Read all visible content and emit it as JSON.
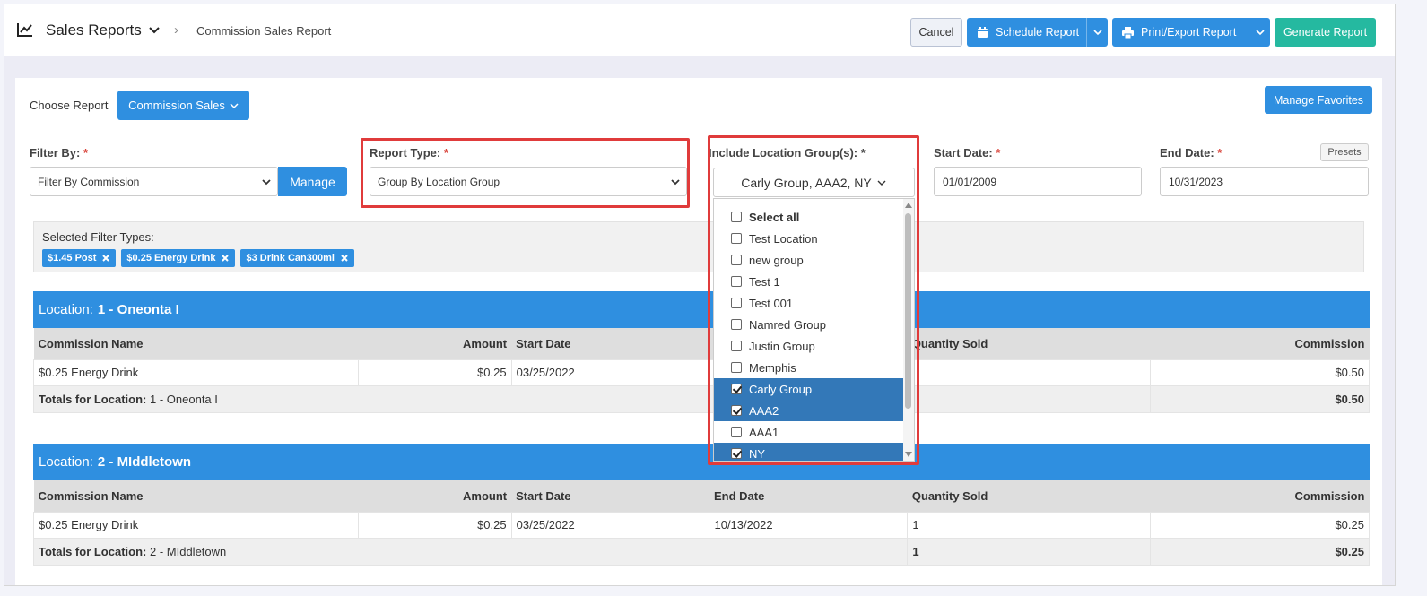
{
  "header": {
    "app_title": "Sales Reports",
    "breadcrumb_current": "Commission Sales Report",
    "cancel_label": "Cancel",
    "schedule_label": "Schedule Report",
    "print_label": "Print/Export Report",
    "generate_label": "Generate Report"
  },
  "choose_report": {
    "label": "Choose Report",
    "value": "Commission Sales"
  },
  "manage_favorites_label": "Manage Favorites",
  "filter_by": {
    "label": "Filter By:",
    "required": "*",
    "value": "Filter By Commission",
    "manage_label": "Manage"
  },
  "report_type": {
    "label": "Report Type:",
    "required": "*",
    "value": "Group By Location Group"
  },
  "location_groups": {
    "label": "Include Location Group(s):",
    "required": "*",
    "value": "Carly Group, AAA2, NY",
    "options": [
      {
        "label": "Select all",
        "checked": false,
        "bold": true
      },
      {
        "label": "Test Location",
        "checked": false
      },
      {
        "label": "new group",
        "checked": false
      },
      {
        "label": "Test 1",
        "checked": false
      },
      {
        "label": "Test 001",
        "checked": false
      },
      {
        "label": "Namred Group",
        "checked": false
      },
      {
        "label": "Justin Group",
        "checked": false
      },
      {
        "label": "Memphis",
        "checked": false
      },
      {
        "label": "Carly Group",
        "checked": true
      },
      {
        "label": "AAA2",
        "checked": true
      },
      {
        "label": "AAA1",
        "checked": false
      },
      {
        "label": "NY",
        "checked": true
      }
    ]
  },
  "start_date": {
    "label": "Start Date:",
    "required": "*",
    "value": "01/01/2009"
  },
  "end_date": {
    "label": "End Date:",
    "required": "*",
    "value": "10/31/2023",
    "presets_label": "Presets"
  },
  "selected_filters": {
    "title": "Selected Filter Types:",
    "chips": [
      "$1.45 Post",
      "$0.25 Energy Drink",
      "$3 Drink Can300ml"
    ]
  },
  "columns": [
    "Commission Name",
    "Amount",
    "Start Date",
    "End Date",
    "Quantity Sold",
    "Commission"
  ],
  "locations": [
    {
      "prefix": "Location:",
      "name": "1 - Oneonta I",
      "row": {
        "name": "$0.25 Energy Drink",
        "amount": "$0.25",
        "start": "03/25/2022",
        "end": "",
        "qty": "",
        "commission": "$0.50"
      },
      "totals": {
        "label": "Totals for Location:",
        "name": "1 - Oneonta I",
        "qty": "",
        "commission": "$0.50"
      }
    },
    {
      "prefix": "Location:",
      "name": "2 - MIddletown",
      "row": {
        "name": "$0.25 Energy Drink",
        "amount": "$0.25",
        "start": "03/25/2022",
        "end": "10/13/2022",
        "qty": "1",
        "commission": "$0.25"
      },
      "totals": {
        "label": "Totals for Location:",
        "name": "2 - MIddletown",
        "qty": "1",
        "commission": "$0.25"
      }
    }
  ],
  "colors": {
    "primary": "#2f8fe0",
    "teal": "#25b9a0",
    "highlight_red": "#e03b3b",
    "selected_option": "#3378b8"
  }
}
